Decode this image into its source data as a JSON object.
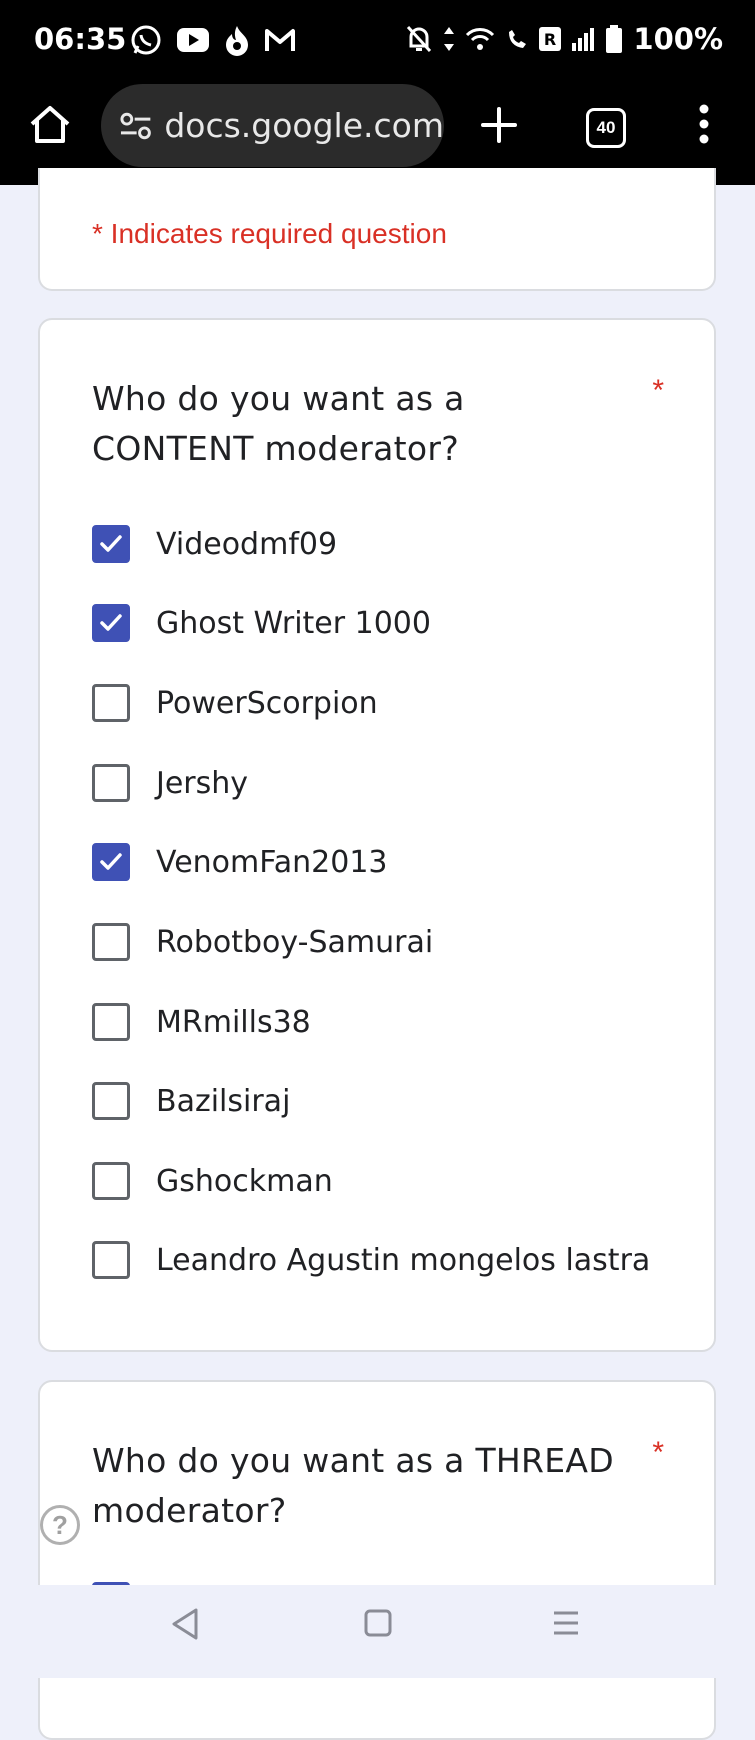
{
  "status_bar": {
    "time": "06:35",
    "app_icons": [
      "whatsapp-icon",
      "youtube-icon",
      "tinder-icon",
      "gmail-icon"
    ],
    "right_icons": [
      "notifications-off-icon",
      "data-arrows-icon",
      "wifi-icon",
      "wifi-calling-icon",
      "roaming-icon",
      "signal-icon",
      "battery-icon"
    ],
    "battery": "100%"
  },
  "browser": {
    "url": "docs.google.com",
    "tab_count": "40"
  },
  "form": {
    "required_note": "* Indicates required question",
    "questions": [
      {
        "title": "Who do you want as a CONTENT moderator?",
        "required_mark": "*",
        "options": [
          {
            "label": "Videodmf09",
            "checked": true
          },
          {
            "label": "Ghost Writer 1000",
            "checked": true
          },
          {
            "label": "PowerScorpion",
            "checked": false
          },
          {
            "label": "Jershy",
            "checked": false
          },
          {
            "label": "VenomFan2013",
            "checked": true
          },
          {
            "label": "Robotboy-Samurai",
            "checked": false
          },
          {
            "label": "MRmills38",
            "checked": false
          },
          {
            "label": "Bazilsiraj",
            "checked": false
          },
          {
            "label": "Gshockman",
            "checked": false
          },
          {
            "label": "Leandro Agustin mongelos lastra",
            "checked": false
          }
        ]
      },
      {
        "title": "Who do you want as a THREAD moderator?",
        "required_mark": "*"
      }
    ],
    "help": "?"
  },
  "colors": {
    "accent": "#3F51B5",
    "required": "#D93025",
    "page_bg": "#EEF0FA"
  }
}
